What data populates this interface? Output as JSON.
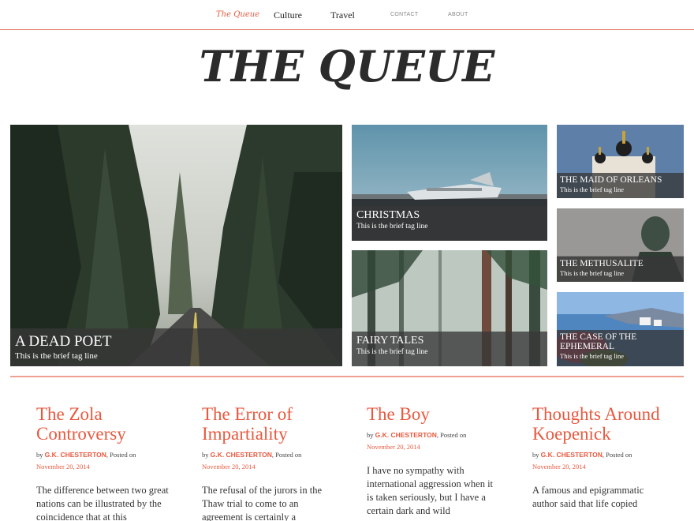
{
  "nav": {
    "brand": "The Queue",
    "items": [
      "Culture",
      "Travel"
    ],
    "contact": "CONTACT",
    "about": "ABOUT"
  },
  "masthead": {
    "title": "THE QUEUE"
  },
  "features": [
    {
      "title": "A DEAD POET",
      "tagline": "This is the brief tag line"
    },
    {
      "title": "CHRISTMAS",
      "tagline": "This is the brief tag line"
    },
    {
      "title": "FAIRY TALES",
      "tagline": "This is the brief tag line"
    },
    {
      "title": "THE MAID OF ORLEANS",
      "tagline": "This is the brief tag line"
    },
    {
      "title": "THE METHUSALITE",
      "tagline": "This is the brief tag line"
    },
    {
      "title": "THE CASE OF THE EPHEMERAL",
      "tagline": "This is the brief tag line"
    }
  ],
  "articles": [
    {
      "title": "The Zola Controversy",
      "by": "by",
      "author": "G.K. CHESTERTON",
      "posted": ", Posted on",
      "date": "November 20, 2014",
      "excerpt": "The difference between two great nations can be illustrated by the coincidence that at this"
    },
    {
      "title": "The Error of Impartiality",
      "by": "by",
      "author": "G.K. CHESTERTON",
      "posted": ", Posted on",
      "date": "November 20, 2014",
      "excerpt": "The refusal of the jurors in the Thaw trial to come to an agreement is certainly a"
    },
    {
      "title": "The Boy",
      "by": "by",
      "author": "G.K. CHESTERTON",
      "posted": ", Posted on",
      "date": "November 20, 2014",
      "excerpt": "I have no sympathy with international aggression when it is taken seriously, but I have a certain dark and wild"
    },
    {
      "title": "Thoughts Around Koepenick",
      "by": "by",
      "author": "G.K. CHESTERTON",
      "posted": ", Posted on",
      "date": "November 20, 2014",
      "excerpt": "A famous and epigrammatic author said that life copied"
    }
  ],
  "colors": {
    "accent": "#e8593f",
    "divider": "#f0a08f",
    "caption_bg": "#373737"
  }
}
